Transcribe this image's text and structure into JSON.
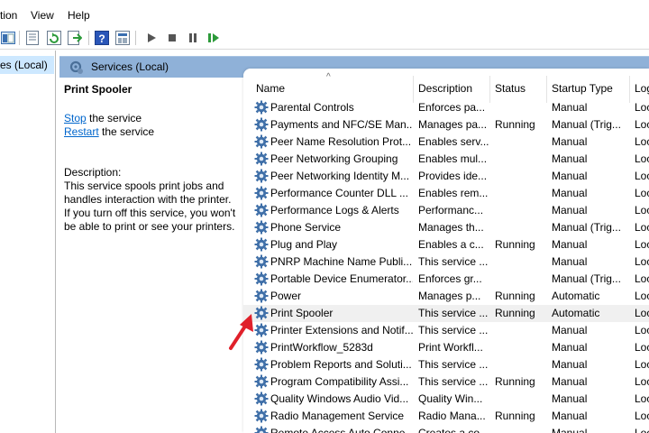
{
  "menubar": {
    "items": [
      "ction",
      "View",
      "Help"
    ]
  },
  "left_tree": {
    "selected_label": "es (Local)"
  },
  "services_header": {
    "title": "Services (Local)"
  },
  "description_pane": {
    "service_title": "Print Spooler",
    "stop_link": "Stop",
    "stop_suffix": " the service",
    "restart_link": "Restart",
    "restart_suffix": " the service",
    "description_label": "Description:",
    "description_lines": [
      "This service spools print jobs and",
      "handles interaction with the printer.",
      "If you turn off this service, you won't",
      "be able to print or see your printers."
    ]
  },
  "list": {
    "columns": {
      "name": "Name",
      "description": "Description",
      "status": "Status",
      "startup": "Startup Type",
      "log": "Log"
    },
    "rows": [
      {
        "name": "Parental Controls",
        "description": "Enforces pa...",
        "status": "",
        "startup": "Manual",
        "log": "Loc"
      },
      {
        "name": "Payments and NFC/SE Man...",
        "description": "Manages pa...",
        "status": "Running",
        "startup": "Manual (Trig...",
        "log": "Loc"
      },
      {
        "name": "Peer Name Resolution Prot...",
        "description": "Enables serv...",
        "status": "",
        "startup": "Manual",
        "log": "Loc"
      },
      {
        "name": "Peer Networking Grouping",
        "description": "Enables mul...",
        "status": "",
        "startup": "Manual",
        "log": "Loc"
      },
      {
        "name": "Peer Networking Identity M...",
        "description": "Provides ide...",
        "status": "",
        "startup": "Manual",
        "log": "Loc"
      },
      {
        "name": "Performance Counter DLL ...",
        "description": "Enables rem...",
        "status": "",
        "startup": "Manual",
        "log": "Loc"
      },
      {
        "name": "Performance Logs & Alerts",
        "description": "Performanc...",
        "status": "",
        "startup": "Manual",
        "log": "Loc"
      },
      {
        "name": "Phone Service",
        "description": "Manages th...",
        "status": "",
        "startup": "Manual (Trig...",
        "log": "Loc"
      },
      {
        "name": "Plug and Play",
        "description": "Enables a c...",
        "status": "Running",
        "startup": "Manual",
        "log": "Loc"
      },
      {
        "name": "PNRP Machine Name Publi...",
        "description": "This service ...",
        "status": "",
        "startup": "Manual",
        "log": "Loc"
      },
      {
        "name": "Portable Device Enumerator...",
        "description": "Enforces gr...",
        "status": "",
        "startup": "Manual (Trig...",
        "log": "Loc"
      },
      {
        "name": "Power",
        "description": "Manages p...",
        "status": "Running",
        "startup": "Automatic",
        "log": "Loc"
      },
      {
        "name": "Print Spooler",
        "description": "This service ...",
        "status": "Running",
        "startup": "Automatic",
        "log": "Loc",
        "selected": true
      },
      {
        "name": "Printer Extensions and Notif...",
        "description": "This service ...",
        "status": "",
        "startup": "Manual",
        "log": "Loc"
      },
      {
        "name": "PrintWorkflow_5283d",
        "description": "Print Workfl...",
        "status": "",
        "startup": "Manual",
        "log": "Loc"
      },
      {
        "name": "Problem Reports and Soluti...",
        "description": "This service ...",
        "status": "",
        "startup": "Manual",
        "log": "Loc"
      },
      {
        "name": "Program Compatibility Assi...",
        "description": "This service ...",
        "status": "Running",
        "startup": "Manual",
        "log": "Loc"
      },
      {
        "name": "Quality Windows Audio Vid...",
        "description": "Quality Win...",
        "status": "",
        "startup": "Manual",
        "log": "Loc"
      },
      {
        "name": "Radio Management Service",
        "description": "Radio Mana...",
        "status": "Running",
        "startup": "Manual",
        "log": "Loc"
      },
      {
        "name": "Remote Access Auto Conne...",
        "description": "Creates a co...",
        "status": "",
        "startup": "Manual",
        "log": "Loc"
      }
    ]
  },
  "colors": {
    "header_blue": "#8fb1d8",
    "tree_selected": "#cde8ff",
    "link": "#0066cc",
    "arrow": "#e0202a"
  }
}
